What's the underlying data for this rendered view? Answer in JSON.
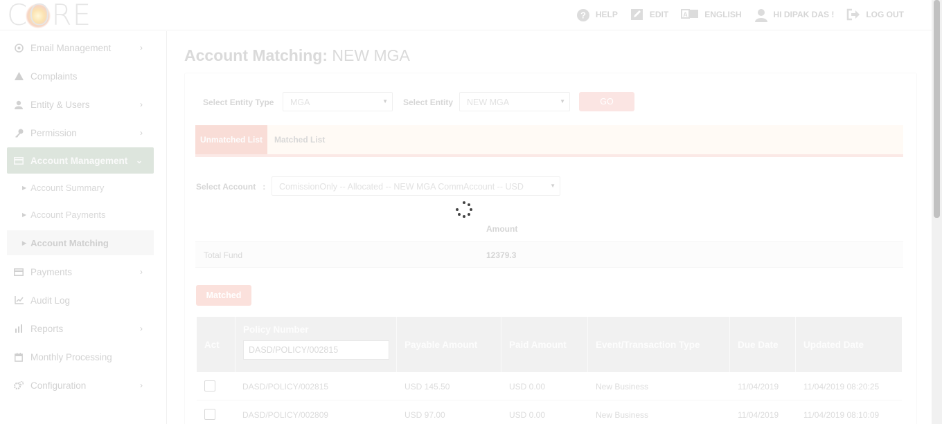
{
  "app": {
    "logo_text": "CORE"
  },
  "topnav": [
    {
      "label": "HELP",
      "icon": "help-icon"
    },
    {
      "label": "EDIT",
      "icon": "edit-icon"
    },
    {
      "label": "ENGLISH",
      "icon": "language-icon"
    },
    {
      "label": "HI DIPAK DAS !",
      "icon": "user-icon"
    },
    {
      "label": "LOG OUT",
      "icon": "logout-icon"
    }
  ],
  "sidebar": {
    "items": [
      {
        "label": "Email Management",
        "icon": "at-icon",
        "chevron": "›"
      },
      {
        "label": "Complaints",
        "icon": "warning-icon",
        "chevron": ""
      },
      {
        "label": "Entity & Users",
        "icon": "user-icon",
        "chevron": "›"
      },
      {
        "label": "Permission",
        "icon": "key-icon",
        "chevron": "›"
      },
      {
        "label": "Account Management",
        "icon": "card-icon",
        "chevron": "⌄"
      },
      {
        "label": "Payments",
        "icon": "card-icon",
        "chevron": "›"
      },
      {
        "label": "Audit Log",
        "icon": "chart-icon",
        "chevron": ""
      },
      {
        "label": "Reports",
        "icon": "report-icon",
        "chevron": "›"
      },
      {
        "label": "Monthly Processing",
        "icon": "calendar-icon",
        "chevron": ""
      },
      {
        "label": "Configuration",
        "icon": "cogs-icon",
        "chevron": "›"
      }
    ],
    "subitems": [
      {
        "label": "Account Summary"
      },
      {
        "label": "Account Payments"
      },
      {
        "label": "Account Matching"
      }
    ]
  },
  "page": {
    "title_bold": "Account Matching:",
    "title_entity": "NEW MGA"
  },
  "filters": {
    "entity_type_label": "Select Entity Type",
    "entity_type_value": "MGA",
    "entity_label": "Select Entity",
    "entity_value": "NEW MGA",
    "go_label": "GO"
  },
  "tabs": [
    {
      "label": "Unmatched List",
      "active": true
    },
    {
      "label": "Matched List",
      "active": false
    }
  ],
  "account": {
    "label": "Select Account",
    "separator": ":",
    "value": "ComissionOnly -- Allocated -- NEW MGA CommAccount -- USD"
  },
  "fund": {
    "amount_header": "Amount",
    "label": "Total Fund",
    "value": "12379.3"
  },
  "matched_button": "Matched",
  "table": {
    "headers": {
      "act": "Act",
      "policy_number": "Policy Number",
      "payable_amount": "Payable Amount",
      "paid_amount": "Paid Amount",
      "event_type": "Event/Transaction Type",
      "due_date": "Due Date",
      "updated_date": "Updated Date"
    },
    "policy_filter_value": "DASD/POLICY/002815",
    "rows": [
      {
        "policy": "DASD/POLICY/002815",
        "payable": "USD 145.50",
        "paid": "USD 0.00",
        "event": "New Business",
        "due": "11/04/2019",
        "updated": "11/04/2019 08:20:25"
      },
      {
        "policy": "DASD/POLICY/002809",
        "payable": "USD 97.00",
        "paid": "USD 0.00",
        "event": "New Business",
        "due": "11/04/2019",
        "updated": "11/04/2019 08:10:09"
      }
    ]
  },
  "colors": {
    "accent": "#f9ddd7",
    "active_sidebar": "#dde5dd",
    "spinner": "#444444"
  }
}
